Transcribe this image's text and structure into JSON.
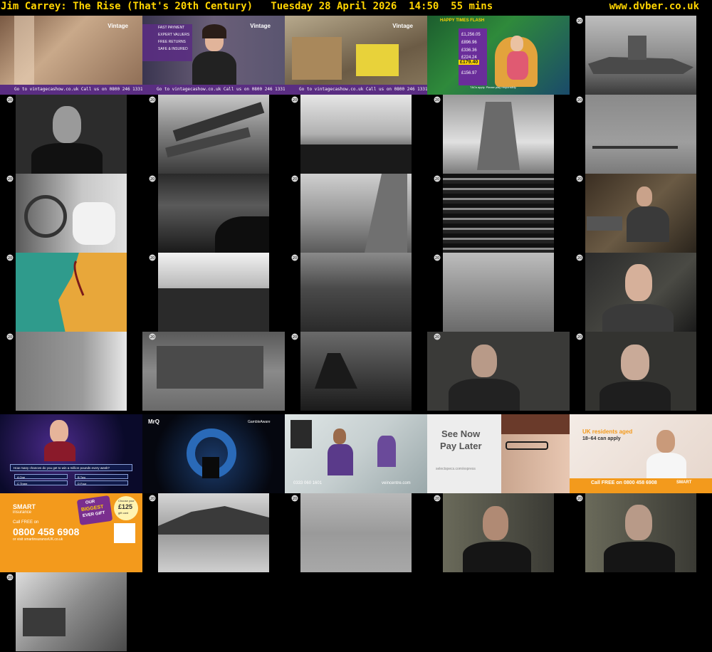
{
  "header": {
    "title": "Jim Carrey: The Rise (That's 20th Century)   Tuesday 28 April 2026  14:50  55 mins",
    "site": "www.dvber.co.uk"
  },
  "colors": {
    "header_text": "#ffd400",
    "background": "#000000",
    "ad_purple": "#5a2d82",
    "ad_orange": "#f39a1c"
  },
  "logo_icon": "channel-20-logo-icon",
  "ads": {
    "vintage": {
      "brand": "Vintage",
      "bar": "Go to vintagecashow.co.uk    Call us on 0800 246 1331",
      "bullets": [
        "FAST PAYMENT",
        "EXPERT VALUERS",
        "FREE RETURNS",
        "SAFE & INSURED"
      ]
    },
    "casino": {
      "title": "HAPPY TIMES FLASH",
      "amounts": [
        "£1,256.05",
        "£896.96",
        "£336.36",
        "£224.24",
        "£179.40",
        "£156.97"
      ],
      "footer": "T&Cs apply. Please play responsibly."
    },
    "quiz": {
      "question": "How many chances do you get to win a million pounds every week?",
      "a": "A  One",
      "b": "B  Two",
      "c": "C  Three",
      "d": "D  Four"
    },
    "mrq": {
      "brand": "MrQ",
      "partner": "GambleAware"
    },
    "vein": {
      "phone": "0333 060 1601",
      "brand": "veincentre.com"
    },
    "specs": {
      "line1": "See Now",
      "line2": "Pay Later",
      "site": "selectspecs.com/express"
    },
    "smart1": {
      "headline": "UK residents aged",
      "sub": "18–64 can apply",
      "phone": "Call FREE on  0800 458 6908",
      "brand": "SMART"
    },
    "smart2": {
      "brand": "SMART",
      "brand_sub": "insurance",
      "call": "Call FREE on",
      "phone": "0800 458 6908",
      "visit": "or visit smartinsuranceUK.co.uk",
      "badge1": "OUR",
      "badge2": "BIGGEST",
      "badge3": "EVER GIFT",
      "gift_a": "Choose your",
      "gift_b": "£125",
      "gift_c": "gift card"
    }
  }
}
